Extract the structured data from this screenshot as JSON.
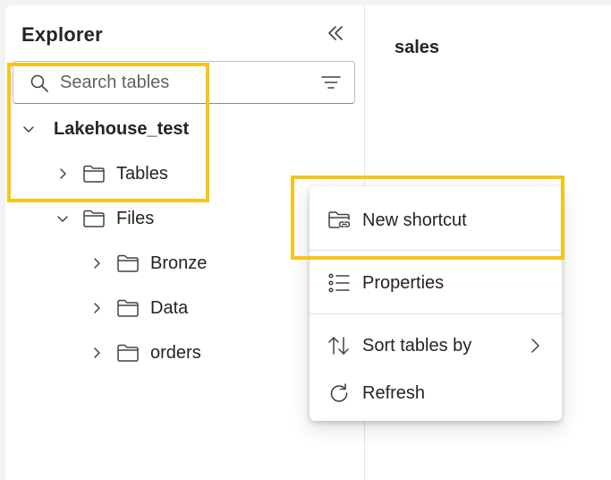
{
  "explorer": {
    "title": "Explorer",
    "search_placeholder": "Search tables",
    "tree": {
      "lakehouse": "Lakehouse_test",
      "tables": "Tables",
      "files": "Files",
      "bronze": "Bronze",
      "data": "Data",
      "orders": "orders"
    }
  },
  "main": {
    "title": "sales"
  },
  "context_menu": {
    "new_shortcut": "New shortcut",
    "properties": "Properties",
    "sort_tables_by": "Sort tables by",
    "refresh": "Refresh"
  },
  "colors": {
    "highlight": "#f5c518",
    "text": "#242424",
    "icon": "#424242"
  },
  "icons": {
    "collapse": "double-chevron-left-icon",
    "search": "search-icon",
    "filter": "filter-icon",
    "folder": "folder-icon",
    "shortcut": "folder-link-icon",
    "properties": "list-icon",
    "sort": "sort-arrows-icon",
    "refresh": "refresh-icon"
  }
}
